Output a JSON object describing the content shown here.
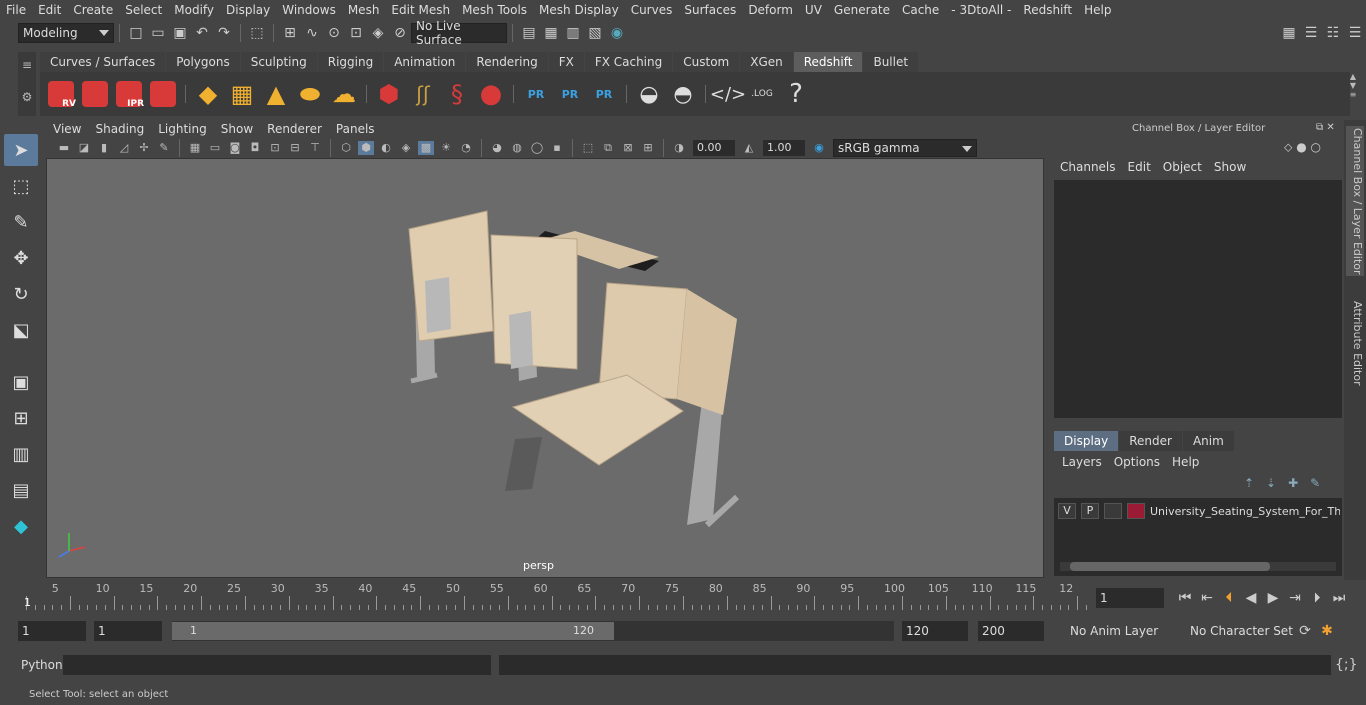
{
  "menu": [
    "File",
    "Edit",
    "Create",
    "Select",
    "Modify",
    "Display",
    "Windows",
    "Mesh",
    "Edit Mesh",
    "Mesh Tools",
    "Mesh Display",
    "Curves",
    "Surfaces",
    "Deform",
    "UV",
    "Generate",
    "Cache",
    "- 3DtoAll -",
    "Redshift",
    "Help"
  ],
  "status": {
    "mode": "Modeling",
    "live_surface": "No Live Surface"
  },
  "shelf_tabs": [
    "Curves / Surfaces",
    "Polygons",
    "Sculpting",
    "Rigging",
    "Animation",
    "Rendering",
    "FX",
    "FX Caching",
    "Custom",
    "XGen",
    "Redshift",
    "Bullet"
  ],
  "active_shelf": "Redshift",
  "shelf_labels": {
    "rv": "RV",
    "ipr": "IPR",
    "pr": "PR",
    "log": ".LOG",
    "help": "?"
  },
  "panel_menu": [
    "View",
    "Shading",
    "Lighting",
    "Show",
    "Renderer",
    "Panels"
  ],
  "panel_toolbar": {
    "exposure": "0.00",
    "gamma": "1.00",
    "colorspace": "sRGB gamma"
  },
  "viewport": {
    "camera": "persp"
  },
  "channel_box": {
    "title": "Channel Box / Layer Editor",
    "menu": [
      "Channels",
      "Edit",
      "Object",
      "Show"
    ]
  },
  "layer_tabs": [
    "Display",
    "Render",
    "Anim"
  ],
  "active_layer_tab": "Display",
  "layer_menu": [
    "Layers",
    "Options",
    "Help"
  ],
  "layer": {
    "v": "V",
    "p": "P",
    "name": "University_Seating_System_For_Three",
    "color": "#9a1b33"
  },
  "side_tabs": [
    "Channel Box / Layer Editor",
    "Attribute Editor"
  ],
  "timeline": {
    "ticks": [
      "5",
      "10",
      "15",
      "20",
      "25",
      "30",
      "35",
      "40",
      "45",
      "50",
      "55",
      "60",
      "65",
      "70",
      "75",
      "80",
      "85",
      "90",
      "95",
      "100",
      "105",
      "110",
      "115",
      "12"
    ],
    "start_label": "1",
    "current_frame": "1"
  },
  "range": {
    "start": "1",
    "start2": "1",
    "slider_start": "1",
    "slider_end": "120",
    "end": "120",
    "end2": "200",
    "anim_layer": "No Anim Layer",
    "char_set": "No Character Set"
  },
  "command": {
    "lang": "Python"
  },
  "help_line": "Select Tool: select an object",
  "colors": {
    "accent": "#5c7a9c",
    "redshift": "#d83a3a",
    "viewport_bg": "#6b6b6b"
  }
}
